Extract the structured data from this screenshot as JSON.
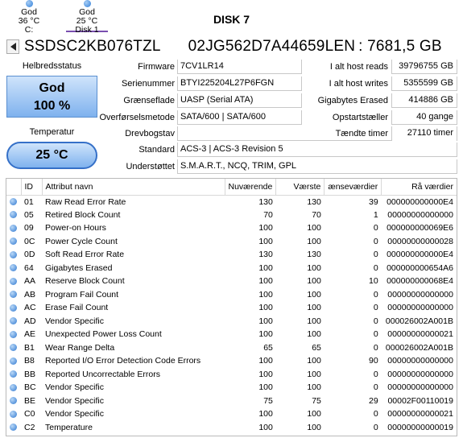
{
  "tabs": [
    {
      "status": "God",
      "temp": "36 °C",
      "name": "C:"
    },
    {
      "status": "God",
      "temp": "25 °C",
      "name": "Disk 1"
    }
  ],
  "disk_title": "DISK 7",
  "model": {
    "name": "SSDSC2KB076TZL",
    "serial_full": "02JG562D7A44659LEN",
    "size": ": 7681,5 GB"
  },
  "health": {
    "label": "Helbredsstatus",
    "status": "God",
    "percent": "100 %"
  },
  "temperature": {
    "label": "Temperatur",
    "value": "25 °C"
  },
  "info_labels": {
    "firmware": "Firmware",
    "serial": "Serienummer",
    "interface": "Grænseflade",
    "transfer": "Overførselsmetode",
    "drive_letter": "Drevbogstav",
    "standard": "Standard",
    "supported": "Understøttet"
  },
  "info": {
    "firmware": "7CV1LR14",
    "serial": "BTYI225204L27P6FGN",
    "interface": "UASP (Serial ATA)",
    "transfer": "SATA/600 | SATA/600",
    "drive_letter": "",
    "standard": "ACS-3 | ACS-3 Revision 5",
    "supported": "S.M.A.R.T., NCQ, TRIM, GPL"
  },
  "stats_labels": {
    "host_reads": "I alt host reads",
    "host_writes": "I alt host writes",
    "gb_erased": "Gigabytes Erased",
    "power_count": "Opstartstæller",
    "power_hours": "Tændte timer"
  },
  "stats": {
    "host_reads": "39796755 GB",
    "host_writes": "5355599 GB",
    "gb_erased": "414886 GB",
    "power_count": "40 gange",
    "power_hours": "27110 timer"
  },
  "table": {
    "headers": [
      "ID",
      "Attribut navn",
      "Nuværende",
      "Værste",
      "ænseværdier",
      "Rå værdier"
    ],
    "rows": [
      [
        "01",
        "Raw Read Error Rate",
        "130",
        "130",
        "39",
        "000000000000E4"
      ],
      [
        "05",
        "Retired Block Count",
        "70",
        "70",
        "1",
        "00000000000000"
      ],
      [
        "09",
        "Power-on Hours",
        "100",
        "100",
        "0",
        "000000000069E6"
      ],
      [
        "0C",
        "Power Cycle Count",
        "100",
        "100",
        "0",
        "00000000000028"
      ],
      [
        "0D",
        "Soft Read Error Rate",
        "130",
        "130",
        "0",
        "000000000000E4"
      ],
      [
        "64",
        "Gigabytes Erased",
        "100",
        "100",
        "0",
        "000000000654A6"
      ],
      [
        "AA",
        "Reserve Block Count",
        "100",
        "100",
        "10",
        "000000000068E4"
      ],
      [
        "AB",
        "Program Fail Count",
        "100",
        "100",
        "0",
        "00000000000000"
      ],
      [
        "AC",
        "Erase Fail Count",
        "100",
        "100",
        "0",
        "00000000000000"
      ],
      [
        "AD",
        "Vendor Specific",
        "100",
        "100",
        "0",
        "000026002A001B"
      ],
      [
        "AE",
        "Unexpected Power Loss Count",
        "100",
        "100",
        "0",
        "00000000000021"
      ],
      [
        "B1",
        "Wear Range Delta",
        "65",
        "65",
        "0",
        "000026002A001B"
      ],
      [
        "B8",
        "Reported I/O Error Detection Code Errors",
        "100",
        "100",
        "90",
        "00000000000000"
      ],
      [
        "BB",
        "Reported Uncorrectable Errors",
        "100",
        "100",
        "0",
        "00000000000000"
      ],
      [
        "BC",
        "Vendor Specific",
        "100",
        "100",
        "0",
        "00000000000000"
      ],
      [
        "BE",
        "Vendor Specific",
        "75",
        "75",
        "29",
        "00002F00110019"
      ],
      [
        "C0",
        "Vendor Specific",
        "100",
        "100",
        "0",
        "00000000000021"
      ],
      [
        "C2",
        "Temperature",
        "100",
        "100",
        "0",
        "00000000000019"
      ]
    ]
  }
}
